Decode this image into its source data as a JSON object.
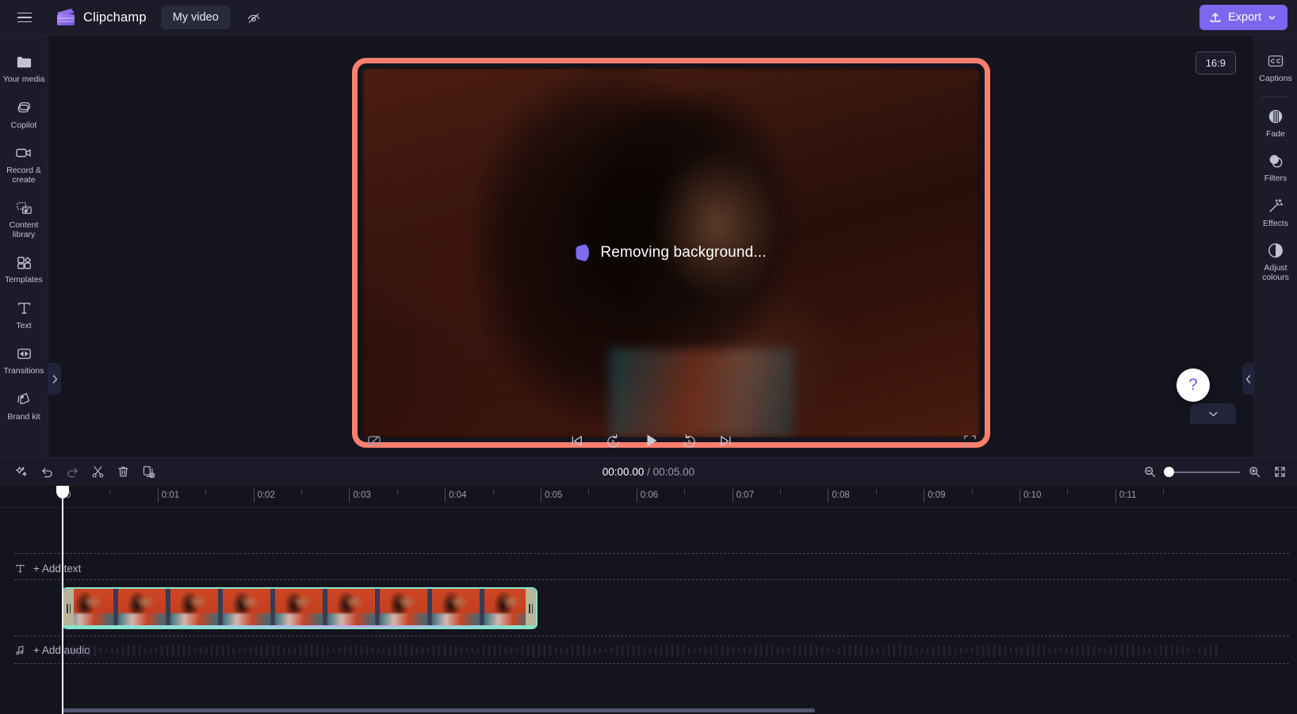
{
  "topbar": {
    "menu_icon": "hamburger-icon",
    "brand": "Clipchamp",
    "project_name": "My video",
    "visibility_icon": "eye-off-icon",
    "export_label": "Export",
    "export_icon": "upload-icon",
    "export_chevron": "chevron-down-icon",
    "accent_color": "#7b68ee"
  },
  "left_rail": {
    "items": [
      {
        "label": "Your media",
        "icon": "folder-icon"
      },
      {
        "label": "Copilot",
        "icon": "copilot-icon"
      },
      {
        "label": "Record & create",
        "icon": "video-camera-icon"
      },
      {
        "label": "Content library",
        "icon": "content-library-icon"
      },
      {
        "label": "Templates",
        "icon": "templates-icon"
      },
      {
        "label": "Text",
        "icon": "text-t-icon"
      },
      {
        "label": "Transitions",
        "icon": "transitions-icon"
      },
      {
        "label": "Brand kit",
        "icon": "brand-kit-icon"
      }
    ],
    "expand_icon": "chevron-right-icon"
  },
  "preview": {
    "status_text": "Removing background...",
    "spinner_icon": "loading-spinner-icon",
    "spinner_color": "#7d6cf0",
    "highlight_border_color": "#ff7f6e",
    "aspect_ratio": "16:9"
  },
  "player": {
    "captions_toggle_icon": "captions-off-icon",
    "skip_start_icon": "skip-to-start-icon",
    "back5_icon": "rewind-5s-icon",
    "back5_label": "5",
    "play_icon": "play-icon",
    "forward5_icon": "forward-5s-icon",
    "forward5_label": "5",
    "skip_end_icon": "skip-to-end-icon",
    "fullscreen_icon": "fullscreen-icon",
    "help_label": "?",
    "collapse_icon": "chevron-down-icon"
  },
  "right_rail": {
    "items": [
      {
        "label": "Captions",
        "icon": "cc-icon"
      },
      {
        "label": "Fade",
        "icon": "fade-icon"
      },
      {
        "label": "Filters",
        "icon": "filters-icon"
      },
      {
        "label": "Effects",
        "icon": "effects-wand-icon"
      },
      {
        "label": "Adjust colours",
        "icon": "adjust-colours-icon"
      }
    ],
    "collapse_icon": "chevron-left-icon"
  },
  "timeline_toolbar": {
    "buttons": [
      {
        "icon": "sparkles-icon",
        "name": "ai-tools-button"
      },
      {
        "icon": "undo-icon",
        "name": "undo-button"
      },
      {
        "icon": "redo-icon",
        "name": "redo-button"
      },
      {
        "icon": "scissors-icon",
        "name": "split-button"
      },
      {
        "icon": "trash-icon",
        "name": "delete-button"
      },
      {
        "icon": "duplicate-icon",
        "name": "duplicate-button"
      }
    ],
    "current_time": "00:00.00",
    "separator": "/",
    "total_time": "00:05.00",
    "zoom_out_icon": "zoom-out-icon",
    "zoom_in_icon": "zoom-in-icon",
    "fit_icon": "fit-to-screen-icon",
    "zoom_value": 0
  },
  "timeline": {
    "ruler_labels": [
      "0",
      "0:01",
      "0:02",
      "0:03",
      "0:04",
      "0:05",
      "0:06",
      "0:07",
      "0:08",
      "0:09",
      "0:10",
      "0:11"
    ],
    "text_track": {
      "label": "+ Add text",
      "icon": "text-t-icon"
    },
    "audio_track": {
      "label": "+ Add audio",
      "icon": "music-note-icon"
    },
    "video_clip": {
      "name": "video-clip",
      "selected": true,
      "selection_color": "#86e6c8",
      "thumbnail_count": 9
    },
    "playhead_position_label": "0"
  }
}
